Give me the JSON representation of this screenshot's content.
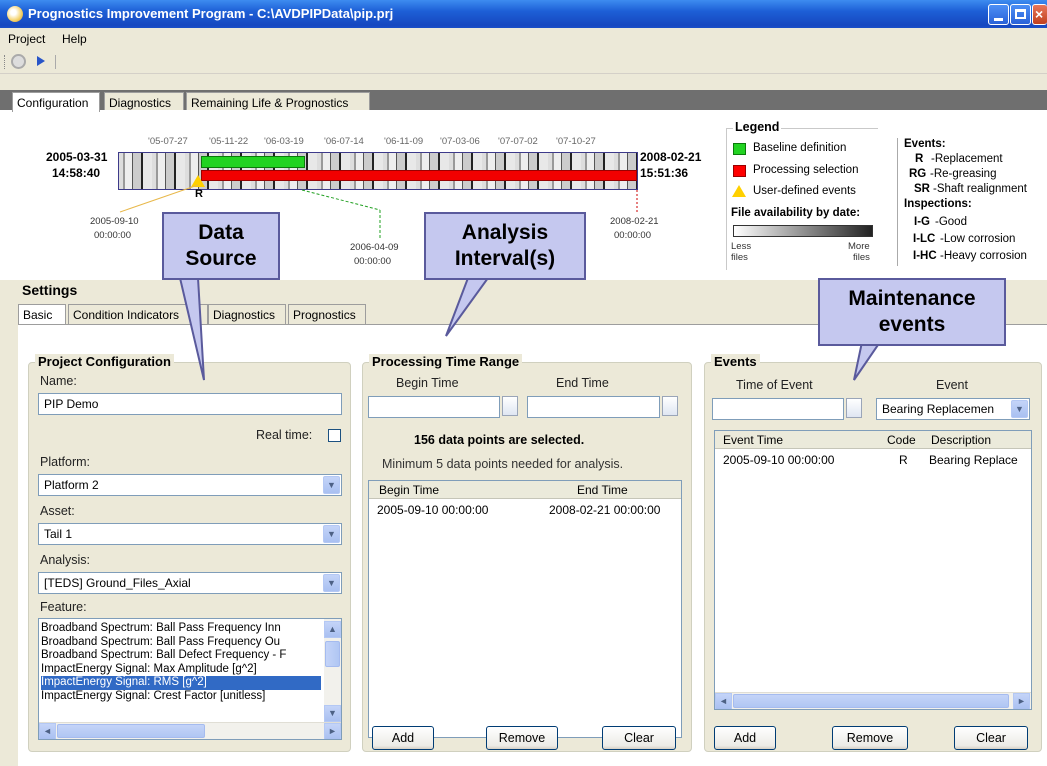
{
  "window": {
    "title": "Prognostics Improvement Program - C:\\AVDPIPData\\pip.prj"
  },
  "menu": {
    "items": [
      "Project",
      "Help"
    ]
  },
  "tabs": [
    "Configuration",
    "Diagnostics",
    "Remaining Life & Prognostics"
  ],
  "timeline": {
    "start_date": "2005-03-31",
    "start_time": "14:58:40",
    "end_date": "2008-02-21",
    "end_time": "15:51:36",
    "ticks": [
      "'05-07-27",
      "'05-11-22",
      "'06-03-19",
      "'06-07-14",
      "'06-11-09",
      "'07-03-06",
      "'07-07-02",
      "'07-10-27"
    ],
    "event_marker": "R",
    "marker_labels": [
      {
        "date": "2005-09-10",
        "time": "00:00:00"
      },
      {
        "date": "2006-04-09",
        "time": "00:00:00"
      },
      {
        "date": "2008-02-21",
        "time": "00:00:00"
      }
    ]
  },
  "legend": {
    "title": "Legend",
    "baseline": "Baseline definition",
    "processing": "Processing selection",
    "user_events": "User-defined events",
    "availability_title": "File availability by date:",
    "less": "Less",
    "more": "More",
    "files": "files",
    "events_title": "Events:",
    "events": [
      {
        "code": "R",
        "desc": "-Replacement"
      },
      {
        "code": "RG",
        "desc": "-Re-greasing"
      },
      {
        "code": "SR",
        "desc": "-Shaft realignment"
      }
    ],
    "inspections_title": "Inspections:",
    "inspections": [
      {
        "code": "I-G",
        "desc": "-Good"
      },
      {
        "code": "I-LC",
        "desc": "-Low corrosion"
      },
      {
        "code": "I-HC",
        "desc": "-Heavy corrosion"
      }
    ],
    "colors": {
      "baseline": "#22d322",
      "processing": "#ff0000",
      "user_event": "#ffd000"
    }
  },
  "callouts": {
    "data_source": [
      "Data",
      "Source"
    ],
    "analysis_interval": [
      "Analysis",
      "Interval(s)"
    ],
    "maintenance": [
      "Maintenance",
      "events"
    ]
  },
  "settings": {
    "title": "Settings",
    "tabs": [
      "Basic",
      "Condition Indicators",
      "Diagnostics",
      "Prognostics"
    ]
  },
  "project_config": {
    "title": "Project Configuration",
    "name_label": "Name:",
    "name_value": "PIP Demo",
    "realtime_label": "Real time:",
    "platform_label": "Platform:",
    "platform_value": "Platform 2",
    "asset_label": "Asset:",
    "asset_value": "Tail 1",
    "analysis_label": "Analysis:",
    "analysis_value": "[TEDS] Ground_Files_Axial",
    "feature_label": "Feature:",
    "features": [
      "Broadband Spectrum: Ball Pass Frequency Inn",
      "Broadband Spectrum: Ball Pass Frequency Ou",
      "Broadband Spectrum: Ball Defect Frequency - F",
      "ImpactEnergy Signal: Max Amplitude [g^2]",
      "ImpactEnergy Signal: RMS [g^2]",
      "ImpactEnergy Signal: Crest Factor [unitless]"
    ]
  },
  "processing": {
    "title": "Processing Time Range",
    "begin_label": "Begin Time",
    "end_label": "End Time",
    "selected_text": "156 data points are selected.",
    "min_text": "Minimum 5 data points needed for analysis.",
    "col_begin": "Begin Time",
    "col_end": "End Time",
    "rows": [
      {
        "begin": "2005-09-10 00:00:00",
        "end": "2008-02-21 00:00:00"
      }
    ],
    "add": "Add",
    "remove": "Remove",
    "clear": "Clear"
  },
  "events": {
    "title": "Events",
    "time_label": "Time of Event",
    "event_label": "Event",
    "event_value": "Bearing Replacemen",
    "col_time": "Event Time",
    "col_code": "Code",
    "col_desc": "Description",
    "rows": [
      {
        "time": "2005-09-10 00:00:00",
        "code": "R",
        "desc": "Bearing Replace"
      }
    ],
    "add": "Add",
    "remove": "Remove",
    "clear": "Clear"
  }
}
